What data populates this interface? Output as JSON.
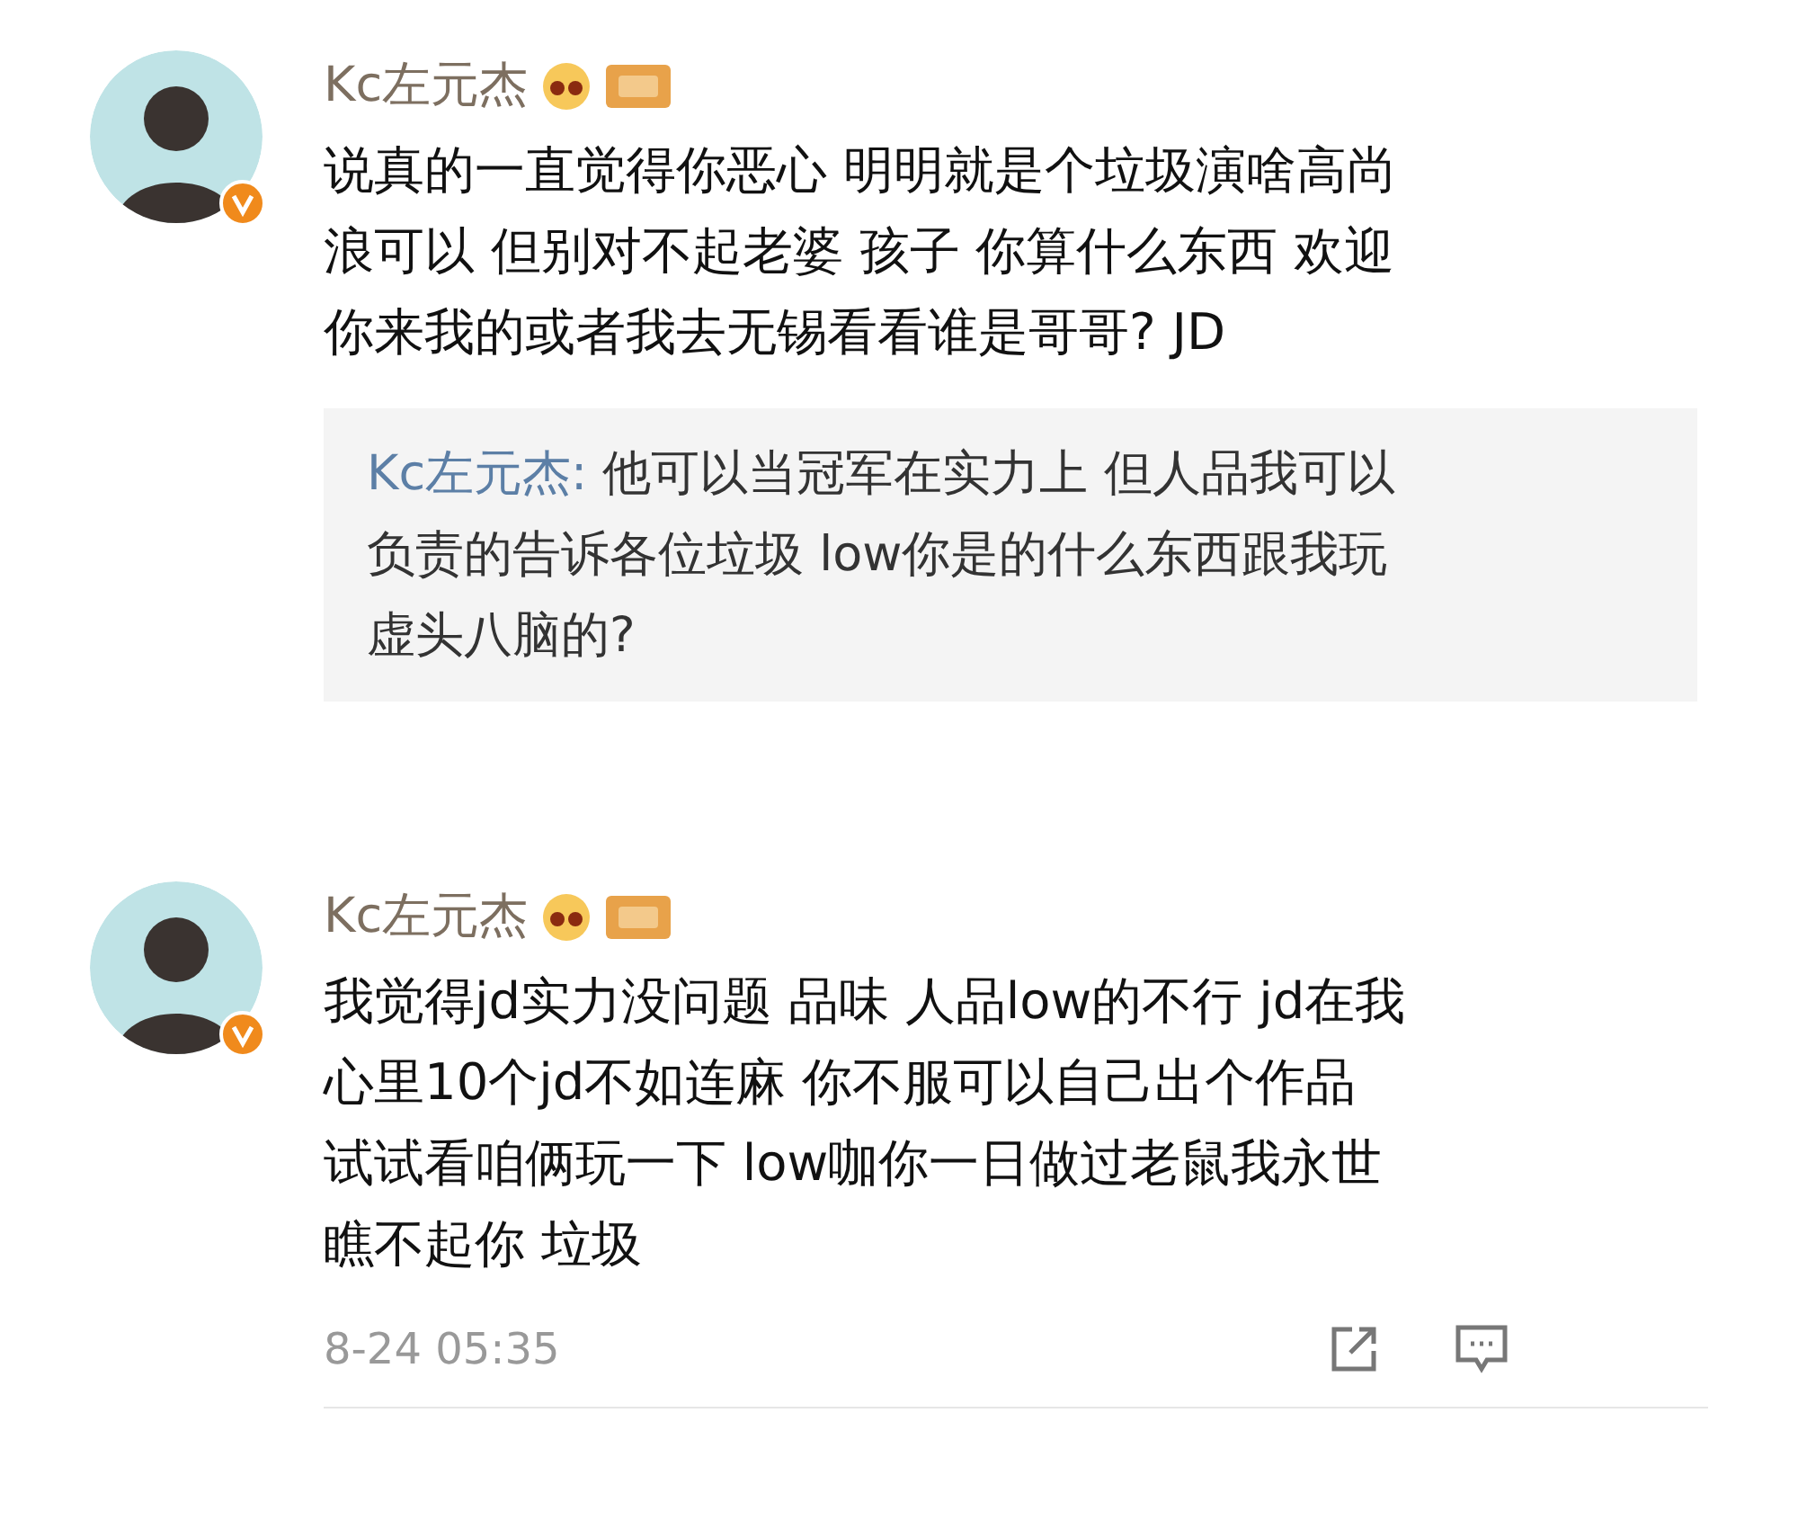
{
  "comments": [
    {
      "author": "Kc左元杰",
      "lines": [
        "说真的一直觉得你恶心 明明就是个垃圾演啥高尚",
        "浪可以 但别对不起老婆 孩子 你算什么东西  欢迎",
        "你来我的或者我去无锡看看谁是哥哥? JD"
      ],
      "quote": {
        "author": "Kc左元杰:",
        "lines": [
          " 他可以当冠军在实力上 但人品我可以",
          "负责的告诉各位垃圾 low你是的什么东西跟我玩",
          "虚头八脑的?"
        ]
      }
    },
    {
      "author": "Kc左元杰",
      "lines": [
        "我觉得jd实力没问题 品味 人品low的不行 jd在我",
        "心里10个jd不如连麻 你不服可以自己出个作品",
        "试试看咱俩玩一下 low咖你一日做过老鼠我永世",
        "瞧不起你 垃圾"
      ],
      "footer": {
        "time": "8-24 05:35"
      }
    }
  ]
}
